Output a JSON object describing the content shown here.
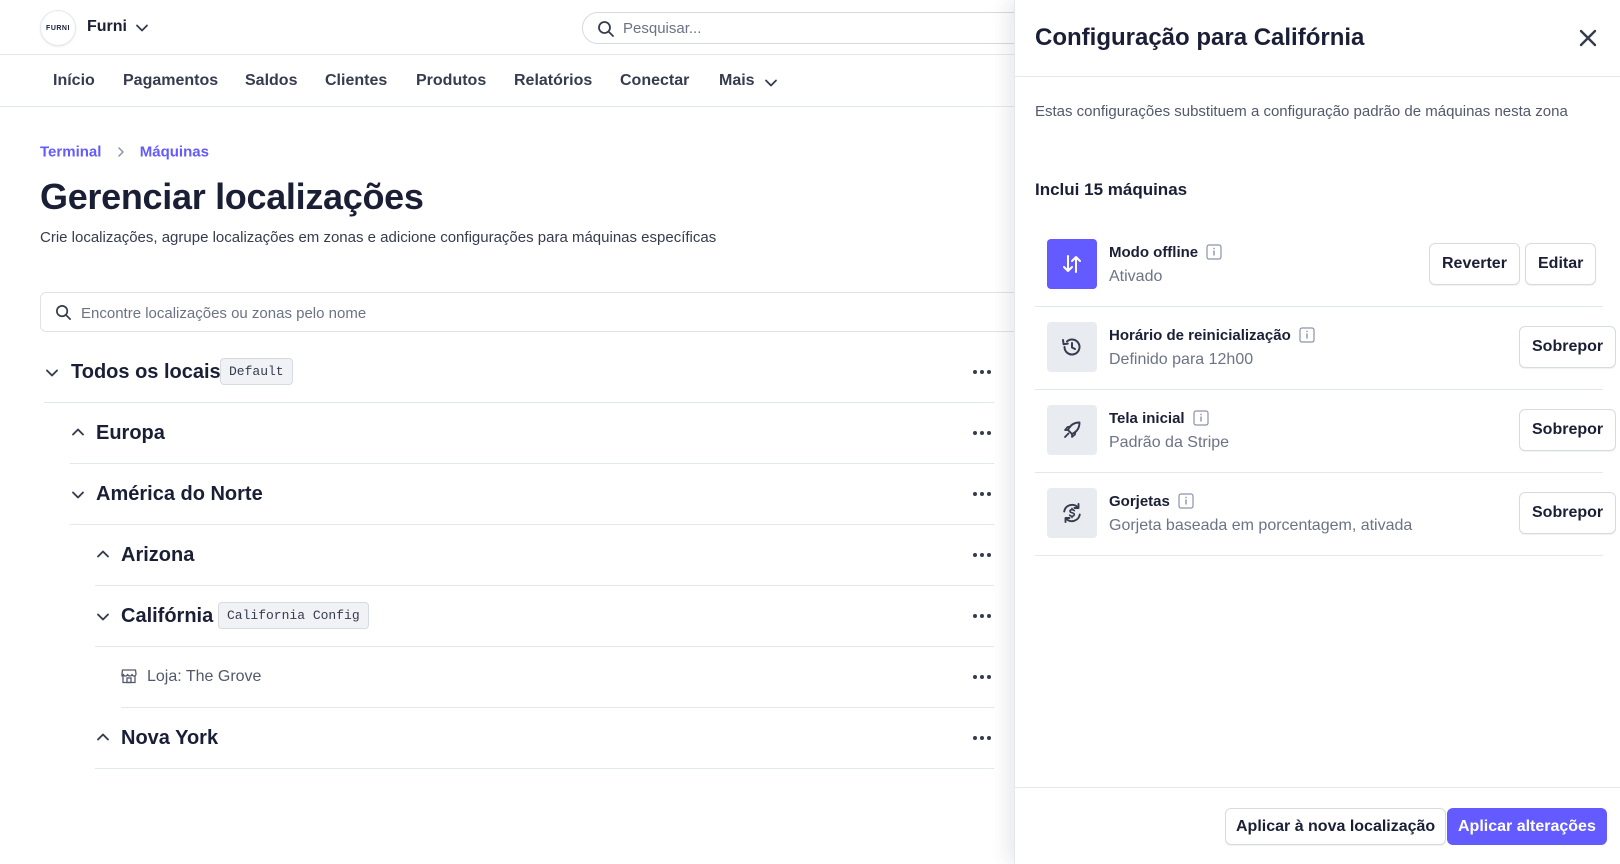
{
  "topbar": {
    "logo_text": "FURNI",
    "brand": "Furni",
    "search_placeholder": "Pesquisar..."
  },
  "nav": {
    "items": [
      "Início",
      "Pagamentos",
      "Saldos",
      "Clientes",
      "Produtos",
      "Relatórios",
      "Conectar",
      "Mais"
    ]
  },
  "breadcrumb": [
    "Terminal",
    "Máquinas"
  ],
  "page": {
    "title": "Gerenciar localizações",
    "subtitle": "Crie localizações, agrupe localizações em zonas e adicione configurações para máquinas específicas",
    "search_placeholder": "Encontre localizações ou zonas pelo nome"
  },
  "tree": [
    {
      "name": "Todos os locais",
      "badge": "Default",
      "expanded": true
    },
    {
      "name": "Europa",
      "expanded": false
    },
    {
      "name": "América do Norte",
      "expanded": true
    },
    {
      "name": "Arizona",
      "expanded": false
    },
    {
      "name": "Califórnia",
      "badge": "California Config",
      "expanded": true
    },
    {
      "name": "Loja: The Grove"
    },
    {
      "name": "Nova York",
      "expanded": false
    }
  ],
  "panel": {
    "title": "Configuração para Califórnia",
    "description": "Estas configurações substituem a configuração padrão de máquinas nesta zona",
    "count_label": "Inclui 15 máquinas",
    "settings": [
      {
        "title": "Modo offline",
        "subtitle": "Ativado",
        "icon": "arrows-up-down-icon",
        "active": true,
        "buttons": [
          "Reverter",
          "Editar"
        ]
      },
      {
        "title": "Horário de reinicialização",
        "subtitle": "Definido para 12h00",
        "icon": "history-icon",
        "active": false,
        "buttons": [
          "Sobrepor"
        ]
      },
      {
        "title": "Tela inicial",
        "subtitle": "Padrão da Stripe",
        "icon": "rocket-icon",
        "active": false,
        "buttons": [
          "Sobrepor"
        ]
      },
      {
        "title": "Gorjetas",
        "subtitle": "Gorjeta baseada em porcentagem, ativada",
        "icon": "tip-icon",
        "active": false,
        "buttons": [
          "Sobrepor"
        ]
      }
    ],
    "footer": {
      "secondary": "Aplicar à nova localização",
      "primary": "Aplicar alterações"
    }
  },
  "colors": {
    "accent": "#635bff",
    "text": "#1a1f36",
    "muted": "#6b7385",
    "border": "#e3e8ee"
  }
}
